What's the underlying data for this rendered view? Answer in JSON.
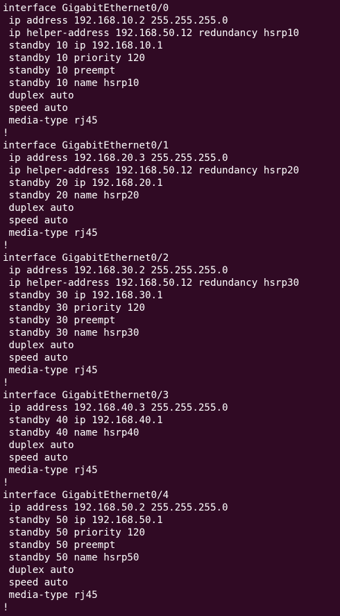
{
  "terminal": {
    "lines": [
      "interface GigabitEthernet0/0",
      " ip address 192.168.10.2 255.255.255.0",
      " ip helper-address 192.168.50.12 redundancy hsrp10",
      " standby 10 ip 192.168.10.1",
      " standby 10 priority 120",
      " standby 10 preempt",
      " standby 10 name hsrp10",
      " duplex auto",
      " speed auto",
      " media-type rj45",
      "!",
      "interface GigabitEthernet0/1",
      " ip address 192.168.20.3 255.255.255.0",
      " ip helper-address 192.168.50.12 redundancy hsrp20",
      " standby 20 ip 192.168.20.1",
      " standby 20 name hsrp20",
      " duplex auto",
      " speed auto",
      " media-type rj45",
      "!",
      "interface GigabitEthernet0/2",
      " ip address 192.168.30.2 255.255.255.0",
      " ip helper-address 192.168.50.12 redundancy hsrp30",
      " standby 30 ip 192.168.30.1",
      " standby 30 priority 120",
      " standby 30 preempt",
      " standby 30 name hsrp30",
      " duplex auto",
      " speed auto",
      " media-type rj45",
      "!",
      "interface GigabitEthernet0/3",
      " ip address 192.168.40.3 255.255.255.0",
      " standby 40 ip 192.168.40.1",
      " standby 40 name hsrp40",
      " duplex auto",
      " speed auto",
      " media-type rj45",
      "!",
      "interface GigabitEthernet0/4",
      " ip address 192.168.50.2 255.255.255.0",
      " standby 50 ip 192.168.50.1",
      " standby 50 priority 120",
      " standby 50 preempt",
      " standby 50 name hsrp50",
      " duplex auto",
      " speed auto",
      " media-type rj45",
      "!"
    ]
  }
}
